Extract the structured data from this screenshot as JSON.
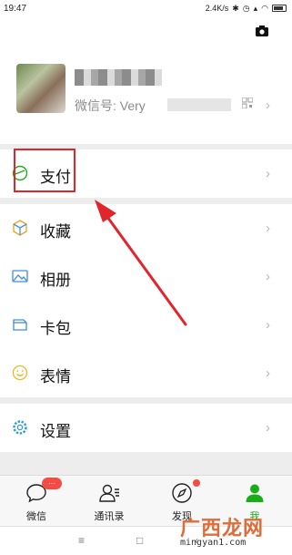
{
  "status_bar": {
    "time": "19:47",
    "speed": "2.4K/s"
  },
  "profile": {
    "wechat_id_label": "微信号: Very"
  },
  "menu": {
    "pay": "支付",
    "favorites": "收藏",
    "album": "相册",
    "cards": "卡包",
    "stickers": "表情",
    "settings": "设置"
  },
  "tabbar": {
    "chats": "微信",
    "chats_badge": "···",
    "contacts": "通讯录",
    "discover": "发现",
    "me": "我"
  },
  "navbar": {
    "menu_glyph": "≡",
    "home_glyph": "□",
    "back_glyph": "‹"
  },
  "watermark": {
    "cn": "广西龙网",
    "en": "mingyan1.com"
  },
  "colors": {
    "accent_green": "#1aad19",
    "highlight_red": "#e2242c",
    "badge_red": "#f44b45"
  }
}
